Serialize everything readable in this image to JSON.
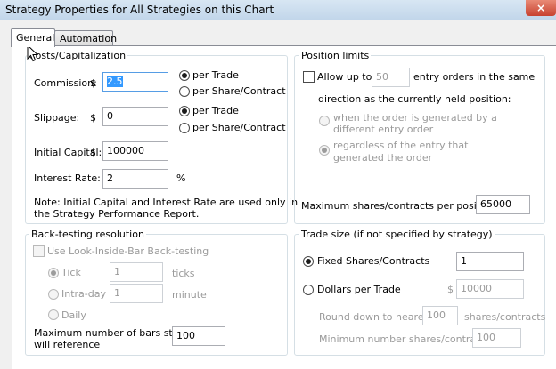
{
  "window": {
    "title": "Strategy Properties for All Strategies on this Chart",
    "close_glyph": "×"
  },
  "tabs": [
    {
      "label": "General"
    },
    {
      "label": "Automation"
    }
  ],
  "costs": {
    "legend": "Costs/Capitalization",
    "commission_label": "Commission:",
    "commission_currency": "$",
    "commission_value": "2.5",
    "slippage_label": "Slippage:",
    "slippage_currency": "$",
    "slippage_value": "0",
    "per_trade": "per Trade",
    "per_share": "per Share/Contract",
    "initial_capital_label": "Initial Capital:",
    "initial_capital_currency": "$",
    "initial_capital_value": "100000",
    "interest_rate_label": "Interest Rate:",
    "interest_rate_value": "2",
    "percent": "%",
    "note_line1": "Note: Initial Capital and Interest Rate are used only in",
    "note_line2": "the Strategy Performance Report."
  },
  "position": {
    "legend": "Position limits",
    "allow_label": "Allow up to",
    "allow_value": "50",
    "entry_line1": "entry orders in the same",
    "entry_line2": "direction as the currently held position:",
    "opt1_line1": "when the order is generated by a",
    "opt1_line2": "different entry order",
    "opt2_line1": "regardless of the entry that",
    "opt2_line2": "generated the order",
    "max_label": "Maximum shares/contracts per position",
    "max_value": "65000"
  },
  "backtest": {
    "legend": "Back-testing resolution",
    "use_label": "Use Look-Inside-Bar Back-testing",
    "tick_label": "Tick",
    "tick_value": "1",
    "tick_unit": "ticks",
    "intraday_label": "Intra-day",
    "intraday_value": "1",
    "intraday_unit": "minute",
    "daily_label": "Daily",
    "maxbars_line1": "Maximum number of bars study",
    "maxbars_line2": "will reference",
    "maxbars_value": "100"
  },
  "tradesize": {
    "legend": "Trade size (if not specified by strategy)",
    "fixed_label": "Fixed Shares/Contracts",
    "fixed_value": "1",
    "dollars_label": "Dollars per Trade",
    "dollars_currency": "$",
    "dollars_value": "10000",
    "round_label": "Round down to nearest",
    "round_value": "100",
    "round_unit": "shares/contracts",
    "min_label": "Minimum number shares/contracts:",
    "min_value": "100"
  }
}
